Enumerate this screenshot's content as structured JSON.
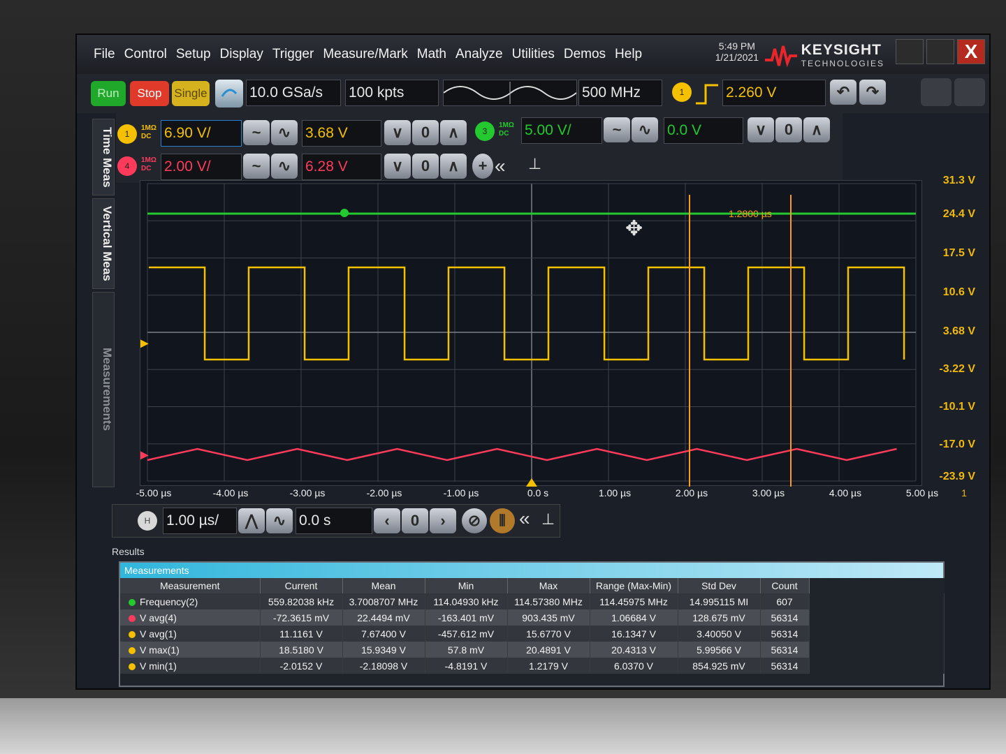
{
  "menu": [
    "File",
    "Control",
    "Setup",
    "Display",
    "Trigger",
    "Measure/Mark",
    "Math",
    "Analyze",
    "Utilities",
    "Demos",
    "Help"
  ],
  "clock": {
    "time": "5:49 PM",
    "date": "1/21/2021"
  },
  "brand": {
    "name": "KEYSIGHT",
    "sub": "TECHNOLOGIES"
  },
  "window": {
    "close": "X"
  },
  "toolbar": {
    "run": "Run",
    "stop": "Stop",
    "single": "Single",
    "sample_rate": "10.0 GSa/s",
    "memory_depth": "100 kpts",
    "bandwidth": "500 MHz",
    "trigger_source": "1",
    "trigger_level": "2.260 V"
  },
  "channels": {
    "ch1": {
      "label": "1",
      "coupling_top": "1MΩ",
      "coupling_bottom": "DC",
      "scale": "6.90 V/",
      "offset": "3.68 V",
      "color": "#f5c000"
    },
    "ch3": {
      "label": "3",
      "coupling_top": "1MΩ",
      "coupling_bottom": "DC",
      "scale": "5.00 V/",
      "offset": "0.0 V",
      "color": "#23c92e"
    },
    "ch4": {
      "label": "4",
      "coupling_top": "1MΩ",
      "coupling_bottom": "DC",
      "scale": "2.00 V/",
      "offset": "6.28 V",
      "color": "#ff3b5c"
    }
  },
  "side_tabs": [
    "Time Meas",
    "Vertical Meas",
    "Measurements"
  ],
  "plot": {
    "voltage_labels": [
      "31.3 V",
      "24.4 V",
      "17.5 V",
      "10.6 V",
      "3.68 V",
      "-3.22 V",
      "-10.1 V",
      "-17.0 V",
      "-23.9 V"
    ],
    "time_labels": [
      "-5.00 µs",
      "-4.00 µs",
      "-3.00 µs",
      "-2.00 µs",
      "-1.00 µs",
      "0.0 s",
      "1.00 µs",
      "2.00 µs",
      "3.00 µs",
      "4.00 µs",
      "5.00 µs"
    ],
    "cursor_delta": "1.2800 µs",
    "page_index": "1"
  },
  "timebase": {
    "label": "H",
    "scale": "1.00 µs/",
    "position": "0.0 s"
  },
  "results": {
    "header": "Results",
    "panel_title": "Measurements",
    "columns": [
      "Measurement",
      "Current",
      "Mean",
      "Min",
      "Max",
      "Range (Max-Min)",
      "Std Dev",
      "Count"
    ],
    "rows": [
      {
        "name": "Frequency(2)",
        "color": "#23c92e",
        "values": [
          "559.82038 kHz",
          "3.7008707 MHz",
          "114.04930 kHz",
          "114.57380 MHz",
          "114.45975 MHz",
          "14.995115 MI",
          "607"
        ]
      },
      {
        "name": "V avg(4)",
        "color": "#ff3b5c",
        "values": [
          "-72.3615 mV",
          "22.4494 mV",
          "-163.401 mV",
          "903.435 mV",
          "1.06684 V",
          "128.675 mV",
          "56314"
        ]
      },
      {
        "name": "V avg(1)",
        "color": "#f5c000",
        "values": [
          "11.1161 V",
          "7.67400 V",
          "-457.612 mV",
          "15.6770 V",
          "16.1347 V",
          "3.40050 V",
          "56314"
        ]
      },
      {
        "name": "V max(1)",
        "color": "#f5c000",
        "values": [
          "18.5180 V",
          "15.9349 V",
          "57.8 mV",
          "20.4891 V",
          "20.4313 V",
          "5.99566 V",
          "56314"
        ]
      },
      {
        "name": "V min(1)",
        "color": "#f5c000",
        "values": [
          "-2.0152 V",
          "-2.18098 V",
          "-4.8191 V",
          "1.2179 V",
          "6.0370 V",
          "854.925 mV",
          "56314"
        ]
      }
    ]
  }
}
